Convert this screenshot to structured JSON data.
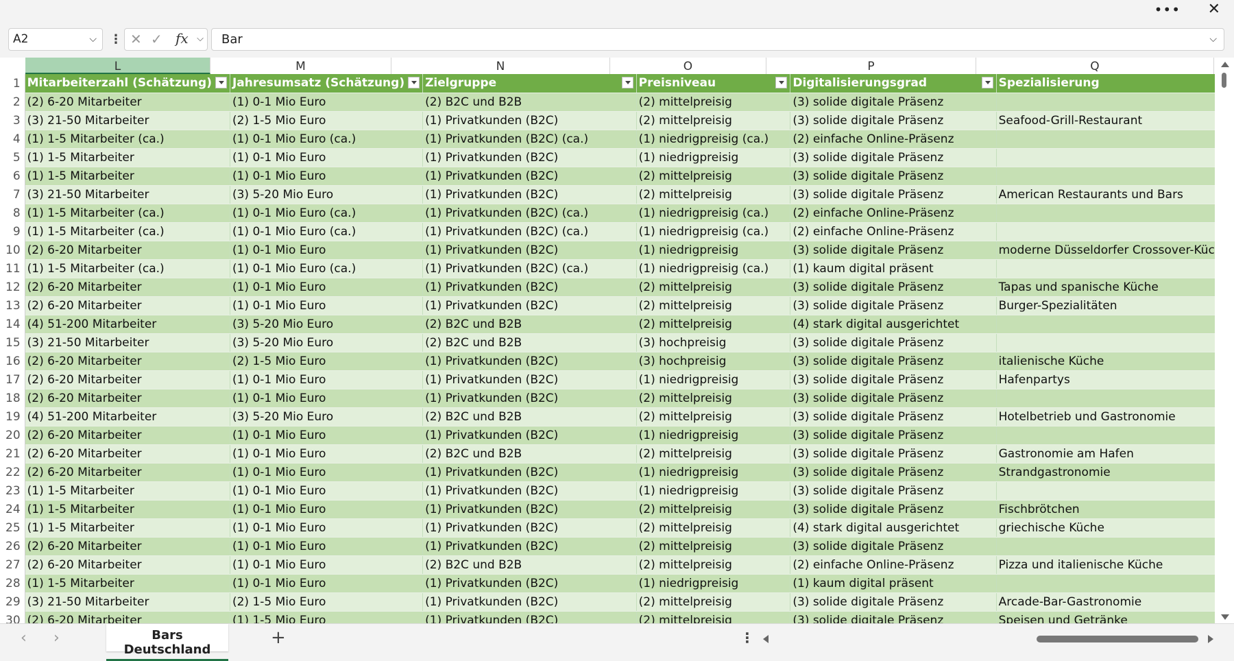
{
  "window": {
    "more_label": "•••",
    "close_label": "✕"
  },
  "formula_bar": {
    "name_box": "A2",
    "formula": "Bar"
  },
  "columns": [
    {
      "letter": "L",
      "header": "Mitarbeiterzahl (Schätzung)",
      "selected": true
    },
    {
      "letter": "M",
      "header": "Jahresumsatz (Schätzung)"
    },
    {
      "letter": "N",
      "header": "Zielgruppe"
    },
    {
      "letter": "O",
      "header": "Preisniveau"
    },
    {
      "letter": "P",
      "header": "Digitalisierungsgrad"
    },
    {
      "letter": "Q",
      "header": "Spezialisierung"
    }
  ],
  "rows": [
    {
      "n": "2",
      "cells": [
        "(2) 6-20 Mitarbeiter",
        "(1) 0-1 Mio Euro",
        "(2) B2C und B2B",
        "(2) mittelpreisig",
        "(3) solide digitale Präsenz",
        ""
      ]
    },
    {
      "n": "3",
      "cells": [
        "(3) 21-50 Mitarbeiter",
        "(2) 1-5 Mio Euro",
        "(1) Privatkunden (B2C)",
        "(2) mittelpreisig",
        "(3) solide digitale Präsenz",
        "Seafood-Grill-Restaurant"
      ]
    },
    {
      "n": "4",
      "cells": [
        "(1) 1-5 Mitarbeiter (ca.)",
        "(1) 0-1 Mio Euro (ca.)",
        "(1) Privatkunden (B2C) (ca.)",
        "(1) niedrigpreisig (ca.)",
        "(2) einfache Online-Präsenz",
        ""
      ]
    },
    {
      "n": "5",
      "cells": [
        "(1) 1-5 Mitarbeiter",
        "(1) 0-1 Mio Euro",
        "(1) Privatkunden (B2C)",
        "(1) niedrigpreisig",
        "(3) solide digitale Präsenz",
        ""
      ]
    },
    {
      "n": "6",
      "cells": [
        "(1) 1-5 Mitarbeiter",
        "(1) 0-1 Mio Euro",
        "(1) Privatkunden (B2C)",
        "(2) mittelpreisig",
        "(3) solide digitale Präsenz",
        ""
      ]
    },
    {
      "n": "7",
      "cells": [
        "(3) 21-50 Mitarbeiter",
        "(3) 5-20 Mio Euro",
        "(1) Privatkunden (B2C)",
        "(2) mittelpreisig",
        "(3) solide digitale Präsenz",
        "American Restaurants und Bars"
      ]
    },
    {
      "n": "8",
      "cells": [
        "(1) 1-5 Mitarbeiter (ca.)",
        "(1) 0-1 Mio Euro (ca.)",
        "(1) Privatkunden (B2C) (ca.)",
        "(1) niedrigpreisig (ca.)",
        "(2) einfache Online-Präsenz",
        ""
      ]
    },
    {
      "n": "9",
      "cells": [
        "(1) 1-5 Mitarbeiter (ca.)",
        "(1) 0-1 Mio Euro (ca.)",
        "(1) Privatkunden (B2C) (ca.)",
        "(1) niedrigpreisig (ca.)",
        "(2) einfache Online-Präsenz",
        ""
      ]
    },
    {
      "n": "10",
      "cells": [
        "(2) 6-20 Mitarbeiter",
        "(1) 0-1 Mio Euro",
        "(1) Privatkunden (B2C)",
        "(1) niedrigpreisig",
        "(3) solide digitale Präsenz",
        "moderne Düsseldorfer Crossover-Küche"
      ]
    },
    {
      "n": "11",
      "cells": [
        "(1) 1-5 Mitarbeiter (ca.)",
        "(1) 0-1 Mio Euro (ca.)",
        "(1) Privatkunden (B2C) (ca.)",
        "(1) niedrigpreisig (ca.)",
        "(1) kaum digital präsent",
        ""
      ]
    },
    {
      "n": "12",
      "cells": [
        "(2) 6-20 Mitarbeiter",
        "(1) 0-1 Mio Euro",
        "(1) Privatkunden (B2C)",
        "(2) mittelpreisig",
        "(3) solide digitale Präsenz",
        "Tapas und spanische Küche"
      ]
    },
    {
      "n": "13",
      "cells": [
        "(2) 6-20 Mitarbeiter",
        "(1) 0-1 Mio Euro",
        "(1) Privatkunden (B2C)",
        "(2) mittelpreisig",
        "(3) solide digitale Präsenz",
        "Burger-Spezialitäten"
      ]
    },
    {
      "n": "14",
      "cells": [
        "(4) 51-200 Mitarbeiter",
        "(3) 5-20 Mio Euro",
        "(2) B2C und B2B",
        "(2) mittelpreisig",
        "(4) stark digital ausgerichtet",
        ""
      ]
    },
    {
      "n": "15",
      "cells": [
        "(3) 21-50 Mitarbeiter",
        "(3) 5-20 Mio Euro",
        "(2) B2C und B2B",
        "(3) hochpreisig",
        "(3) solide digitale Präsenz",
        ""
      ]
    },
    {
      "n": "16",
      "cells": [
        "(2) 6-20 Mitarbeiter",
        "(2) 1-5 Mio Euro",
        "(1) Privatkunden (B2C)",
        "(3) hochpreisig",
        "(3) solide digitale Präsenz",
        "italienische Küche"
      ]
    },
    {
      "n": "17",
      "cells": [
        "(2) 6-20 Mitarbeiter",
        "(1) 0-1 Mio Euro",
        "(1) Privatkunden (B2C)",
        "(1) niedrigpreisig",
        "(3) solide digitale Präsenz",
        "Hafenpartys"
      ]
    },
    {
      "n": "18",
      "cells": [
        "(2) 6-20 Mitarbeiter",
        "(1) 0-1 Mio Euro",
        "(1) Privatkunden (B2C)",
        "(2) mittelpreisig",
        "(3) solide digitale Präsenz",
        ""
      ]
    },
    {
      "n": "19",
      "cells": [
        "(4) 51-200 Mitarbeiter",
        "(3) 5-20 Mio Euro",
        "(2) B2C und B2B",
        "(2) mittelpreisig",
        "(3) solide digitale Präsenz",
        "Hotelbetrieb und Gastronomie"
      ]
    },
    {
      "n": "20",
      "cells": [
        "(2) 6-20 Mitarbeiter",
        "(1) 0-1 Mio Euro",
        "(1) Privatkunden (B2C)",
        "(1) niedrigpreisig",
        "(3) solide digitale Präsenz",
        ""
      ]
    },
    {
      "n": "21",
      "cells": [
        "(2) 6-20 Mitarbeiter",
        "(1) 0-1 Mio Euro",
        "(2) B2C und B2B",
        "(2) mittelpreisig",
        "(3) solide digitale Präsenz",
        "Gastronomie am Hafen"
      ]
    },
    {
      "n": "22",
      "cells": [
        "(2) 6-20 Mitarbeiter",
        "(1) 0-1 Mio Euro",
        "(1) Privatkunden (B2C)",
        "(1) niedrigpreisig",
        "(3) solide digitale Präsenz",
        "Strandgastronomie"
      ]
    },
    {
      "n": "23",
      "cells": [
        "(1) 1-5 Mitarbeiter",
        "(1) 0-1 Mio Euro",
        "(1) Privatkunden (B2C)",
        "(1) niedrigpreisig",
        "(3) solide digitale Präsenz",
        ""
      ]
    },
    {
      "n": "24",
      "cells": [
        "(1) 1-5 Mitarbeiter",
        "(1) 0-1 Mio Euro",
        "(1) Privatkunden (B2C)",
        "(2) mittelpreisig",
        "(3) solide digitale Präsenz",
        "Fischbrötchen"
      ]
    },
    {
      "n": "25",
      "cells": [
        "(1) 1-5 Mitarbeiter",
        "(1) 0-1 Mio Euro",
        "(1) Privatkunden (B2C)",
        "(2) mittelpreisig",
        "(4) stark digital ausgerichtet",
        "griechische Küche"
      ]
    },
    {
      "n": "26",
      "cells": [
        "(2) 6-20 Mitarbeiter",
        "(1) 0-1 Mio Euro",
        "(1) Privatkunden (B2C)",
        "(2) mittelpreisig",
        "(3) solide digitale Präsenz",
        ""
      ]
    },
    {
      "n": "27",
      "cells": [
        "(2) 6-20 Mitarbeiter",
        "(1) 0-1 Mio Euro",
        "(2) B2C und B2B",
        "(2) mittelpreisig",
        "(2) einfache Online-Präsenz",
        "Pizza und italienische Küche"
      ]
    },
    {
      "n": "28",
      "cells": [
        "(1) 1-5 Mitarbeiter",
        "(1) 0-1 Mio Euro",
        "(1) Privatkunden (B2C)",
        "(1) niedrigpreisig",
        "(1) kaum digital präsent",
        ""
      ]
    },
    {
      "n": "29",
      "cells": [
        "(3) 21-50 Mitarbeiter",
        "(2) 1-5 Mio Euro",
        "(1) Privatkunden (B2C)",
        "(2) mittelpreisig",
        "(3) solide digitale Präsenz",
        "Arcade-Bar-Gastronomie"
      ]
    },
    {
      "n": "30",
      "cells": [
        "(2) 6-20 Mitarbeiter",
        "(1) 1-5 Mio Euro",
        "(1) Privatkunden (B2C)",
        "(2) mittelpreisig",
        "(3) solide digitale Präsenz",
        "Speisen und Getränke"
      ]
    }
  ],
  "sheet_tabs": [
    {
      "label": "Bars Deutschland",
      "active": true
    }
  ],
  "tabbar": {
    "add_label": "+",
    "prev_label": "‹",
    "next_label": "›"
  }
}
